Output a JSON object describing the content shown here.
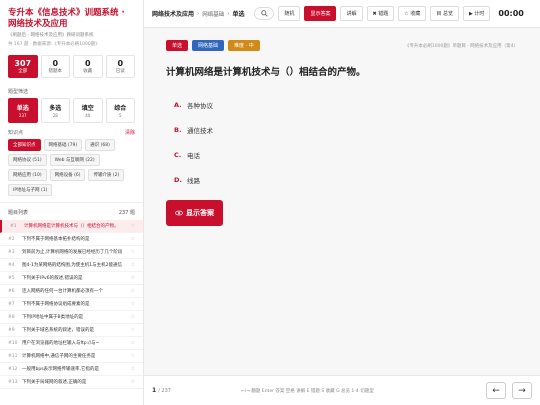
{
  "sidebar": {
    "title": "专升本《信息技术》训题系统 · 网络技术及应用",
    "subtitle": "《刷题后 - 网络技术及应用》教研训题系统",
    "meta": "共 167 题 · 数据来源:《专升本必刷1000题》",
    "stats": [
      {
        "n": "307",
        "l": "全部"
      },
      {
        "n": "0",
        "l": "错题本"
      },
      {
        "n": "0",
        "l": "收藏"
      },
      {
        "n": "0",
        "l": "已读"
      }
    ],
    "types_label": "题型筛选",
    "types": [
      {
        "n": "单选",
        "l": "237"
      },
      {
        "n": "多选",
        "l": "28"
      },
      {
        "n": "填空",
        "l": "40"
      },
      {
        "n": "综合",
        "l": "5"
      }
    ],
    "kp_label": "知识点",
    "kp_clear": "清除",
    "chips": [
      "全部知识点",
      "网络基础 (79)",
      "通识 (68)",
      "网络协议 (51)",
      "Web 与互联网 (22)",
      "网络应用 (10)",
      "网络设备 (6)",
      "传输介质 (2)",
      "IP地址与子网 (1)"
    ],
    "list_label": "题目列表",
    "list_count": "237 题",
    "questions": [
      {
        "num": "#1",
        "text": "计算机网络是计算机技术与（）相结合的产物。"
      },
      {
        "num": "#2",
        "text": "下列不属于网络基本拓扑结构的是"
      },
      {
        "num": "#3",
        "text": "到目前为止,计算机网络的发展已经经历了几个阶段"
      },
      {
        "num": "#4",
        "text": "图4-1为某网络的结构图,为使主机1与主机2能通信"
      },
      {
        "num": "#5",
        "text": "下列关于IPv6的叙述,错误的是"
      },
      {
        "num": "#6",
        "text": "连入网络的任何一台计算机都必须有一个"
      },
      {
        "num": "#7",
        "text": "下列不属于网络协议组成要素的是"
      },
      {
        "num": "#8",
        "text": "下列IP地址中属于B类地址的是"
      },
      {
        "num": "#9",
        "text": "下列关于域名系统的叙述，错误的是"
      },
      {
        "num": "#10",
        "text": "用户在浏览器的地址栏输入与ftp://与~"
      },
      {
        "num": "#11",
        "text": "计算机网络中,通信子网的主要任务是"
      },
      {
        "num": "#12",
        "text": "一般用bps表示网络传输速率,它指的是"
      },
      {
        "num": "#13",
        "text": "下列关于局域网的叙述,正确的是"
      }
    ]
  },
  "topbar": {
    "crumb_main": "网络技术及应用",
    "crumb_sep1": "›",
    "crumb_section": "网络基础",
    "crumb_sep2": "›",
    "crumb_type": "单选",
    "search_icon": "search-icon",
    "buttons": [
      "随机",
      "显示答案",
      "讲解",
      "✖ 错题",
      "☆ 收藏",
      "目 总览",
      "▶ 计时"
    ],
    "timer": "00:00"
  },
  "question": {
    "tags": [
      "单选",
      "网络基础",
      "难度 · 中"
    ],
    "source": "《专升本必刷1000题》单题目 · 网络技术及应用（第4）",
    "title": "计算机网络是计算机技术与（）相结合的产物。",
    "options": [
      {
        "key": "A.",
        "text": "各种协议"
      },
      {
        "key": "B.",
        "text": "通信技术"
      },
      {
        "key": "C.",
        "text": "电话"
      },
      {
        "key": "D.",
        "text": "线路"
      }
    ],
    "show_answer": "显示答案",
    "eye_icon": "eye-icon"
  },
  "bottombar": {
    "page": "1",
    "total": "/ 237",
    "hints": "←/→ 翻题   Enter 答案   空格 讲解   E 错题   S 收藏   G 总览   1-4 切题型",
    "prev": "←",
    "next": "→"
  },
  "colors": {
    "accent": "#c8102e",
    "blue": "#3066be",
    "orange": "#d08a15"
  }
}
